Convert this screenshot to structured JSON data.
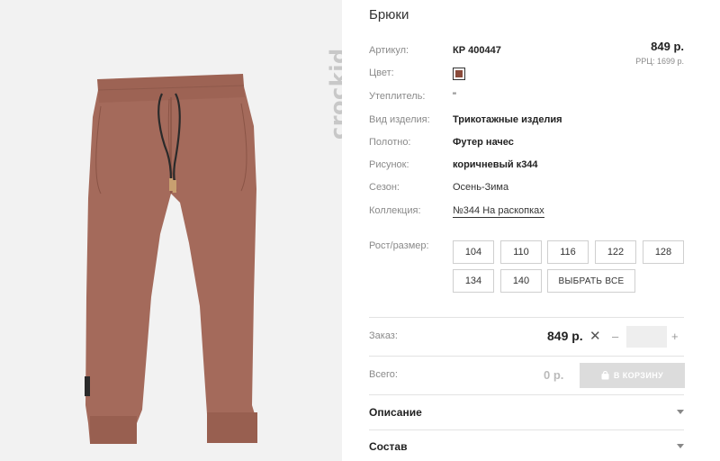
{
  "product": {
    "title": "Брюки",
    "price": "849 р.",
    "rrc": "РРЦ: 1699 р."
  },
  "brand": {
    "logo_text": "crockid"
  },
  "specs": [
    {
      "label": "Артикул:",
      "value": "КР 400447"
    },
    {
      "label": "Цвет:",
      "value": "",
      "swatch_color": "#8a4a3a"
    },
    {
      "label": "Утеплитель:",
      "value": "\""
    },
    {
      "label": "Вид изделия:",
      "value": "Трикотажные изделия"
    },
    {
      "label": "Полотно:",
      "value": "Футер начес"
    },
    {
      "label": "Рисунок:",
      "value": "коричневый к344"
    },
    {
      "label": "Сезон:",
      "value": "Осень-Зима"
    },
    {
      "label": "Коллекция:",
      "value": "№344 На раскопках"
    }
  ],
  "sizes": {
    "label": "Рост/размер:",
    "options": [
      "104",
      "110",
      "116",
      "122",
      "128",
      "134",
      "140"
    ],
    "select_all": "ВЫБРАТЬ ВСЕ"
  },
  "order": {
    "label": "Заказ:",
    "price": "849 р.",
    "times": "✕",
    "minus": "–",
    "plus": "+",
    "quantity": ""
  },
  "total": {
    "label": "Всего:",
    "value": "0 р.",
    "cart_button": "В КОРЗИНУ",
    "cart_icon": "bag-icon"
  },
  "accordion": [
    {
      "title": "Описание",
      "icon": "chevron-down-icon"
    },
    {
      "title": "Состав",
      "icon": "chevron-down-icon"
    }
  ],
  "colors": {
    "product": "#a0695a",
    "swatch": "#8a4a3a",
    "button_disabled": "#dcdcdc"
  }
}
